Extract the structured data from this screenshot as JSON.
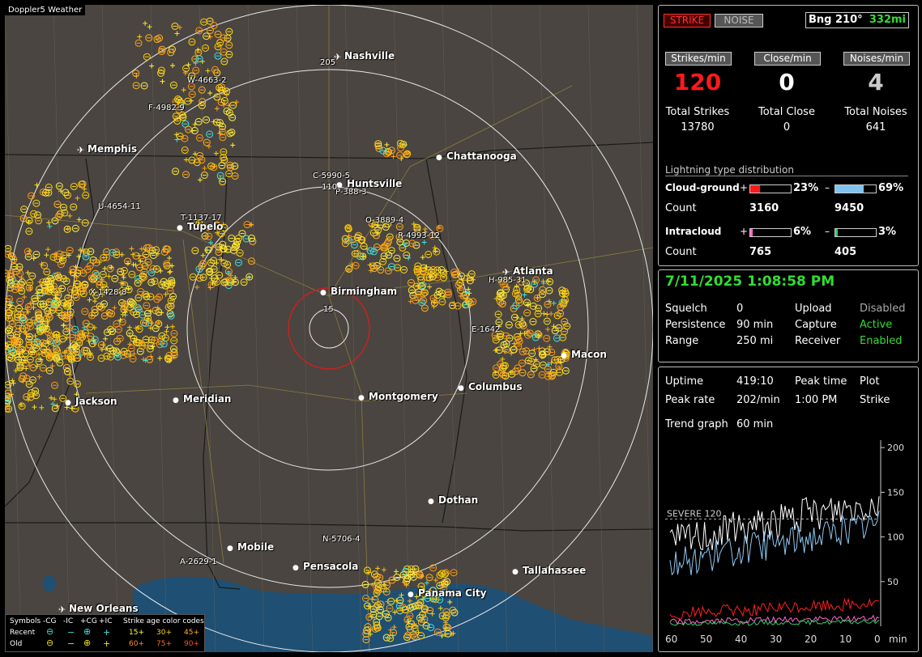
{
  "app": {
    "title": "Doppler5 Weather"
  },
  "map": {
    "cities": [
      {
        "name": "Nashville",
        "kind": "airport"
      },
      {
        "name": "Memphis",
        "kind": "airport"
      },
      {
        "name": "Chattanooga",
        "kind": "city"
      },
      {
        "name": "Huntsville",
        "kind": "city"
      },
      {
        "name": "Tupelo",
        "kind": "city"
      },
      {
        "name": "Birmingham",
        "kind": "city"
      },
      {
        "name": "Atlanta",
        "kind": "airport"
      },
      {
        "name": "Macon",
        "kind": "city"
      },
      {
        "name": "Columbus",
        "kind": "city"
      },
      {
        "name": "Meridian",
        "kind": "city"
      },
      {
        "name": "Montgomery",
        "kind": "city"
      },
      {
        "name": "Jackson",
        "kind": "city"
      },
      {
        "name": "Dothan",
        "kind": "city"
      },
      {
        "name": "Mobile",
        "kind": "city"
      },
      {
        "name": "Pensacola",
        "kind": "city"
      },
      {
        "name": "Tallahassee",
        "kind": "city"
      },
      {
        "name": "Panama City",
        "kind": "city"
      },
      {
        "name": "New Orleans",
        "kind": "airport"
      }
    ],
    "ring_labels": [
      "205",
      "110",
      "15"
    ],
    "cell_labels": [
      "W-4663-2",
      "F-4982-9",
      "C-5990-5",
      "P-388-3",
      "U-4654-11",
      "T-1137-17",
      "O-3889-4",
      "R-4993-12",
      "X-1428-8",
      "H-985-31",
      "E-1642",
      "N-5706-4",
      "A-2629-1"
    ]
  },
  "legend": {
    "symbols_header": "Symbols",
    "col_headers": [
      "-CG",
      "-IC",
      "+CG",
      "+IC"
    ],
    "rows": [
      "Recent",
      "Old"
    ],
    "age_header": "Strike age color codes",
    "ages_recent": [
      "15+",
      "30+",
      "45+"
    ],
    "ages_old": [
      "60+",
      "75+",
      "90+"
    ]
  },
  "panel_top": {
    "strike_btn": "STRIKE",
    "noise_btn": "NOISE",
    "bearing": "Bng 210°",
    "distance": "332mi",
    "rates": [
      {
        "label": "Strikes/min",
        "value": "120",
        "total_label": "Total Strikes",
        "total": "13780",
        "color": "#ff1a1a"
      },
      {
        "label": "Close/min",
        "value": "0",
        "total_label": "Total Close",
        "total": "0",
        "color": "#ffffff"
      },
      {
        "label": "Noises/min",
        "value": "4",
        "total_label": "Total Noises",
        "total": "641",
        "color": "#cccccc"
      }
    ],
    "dist_title": "Lightning type distribution",
    "cg_label": "Cloud-ground",
    "ic_label": "Intracloud",
    "count_label": "Count",
    "plus": "+",
    "minus": "–",
    "cg_plus": {
      "pct": "23%",
      "count": "3160",
      "fraction": 0.23,
      "color": "#ff1a1a"
    },
    "cg_minus": {
      "pct": "69%",
      "count": "9450",
      "fraction": 0.69,
      "color": "#7fc4f0"
    },
    "ic_plus": {
      "pct": "6%",
      "count": "765",
      "fraction": 0.06,
      "color": "#ff66cc"
    },
    "ic_minus": {
      "pct": "3%",
      "count": "405",
      "fraction": 0.03,
      "color": "#33cc66"
    }
  },
  "panel_mid": {
    "datetime": "7/11/2025 1:08:58 PM",
    "rows": [
      {
        "k1": "Squelch",
        "v1": "0",
        "k2": "Upload",
        "v2": "Disabled",
        "c2": "#aaaaaa"
      },
      {
        "k1": "Persistence",
        "v1": "90 min",
        "k2": "Capture",
        "v2": "Active",
        "c2": "#33dd33"
      },
      {
        "k1": "Range",
        "v1": "250 mi",
        "k2": "Receiver",
        "v2": "Enabled",
        "c2": "#33dd33"
      }
    ]
  },
  "panel_bot": {
    "uptime_label": "Uptime",
    "uptime": "419:10",
    "peak_time_label": "Peak time",
    "plot_label": "Plot",
    "peak_rate_label": "Peak rate",
    "peak_rate": "202/min",
    "peak_time": "1:00 PM",
    "plot": "Strike",
    "trend_label": "Trend graph",
    "trend": "60 min",
    "severe": "SEVERE 120",
    "y_ticks": [
      "200",
      "150",
      "100",
      "50"
    ],
    "x_ticks": [
      "60",
      "50",
      "40",
      "30",
      "20",
      "10",
      "0"
    ],
    "x_unit": "min"
  }
}
